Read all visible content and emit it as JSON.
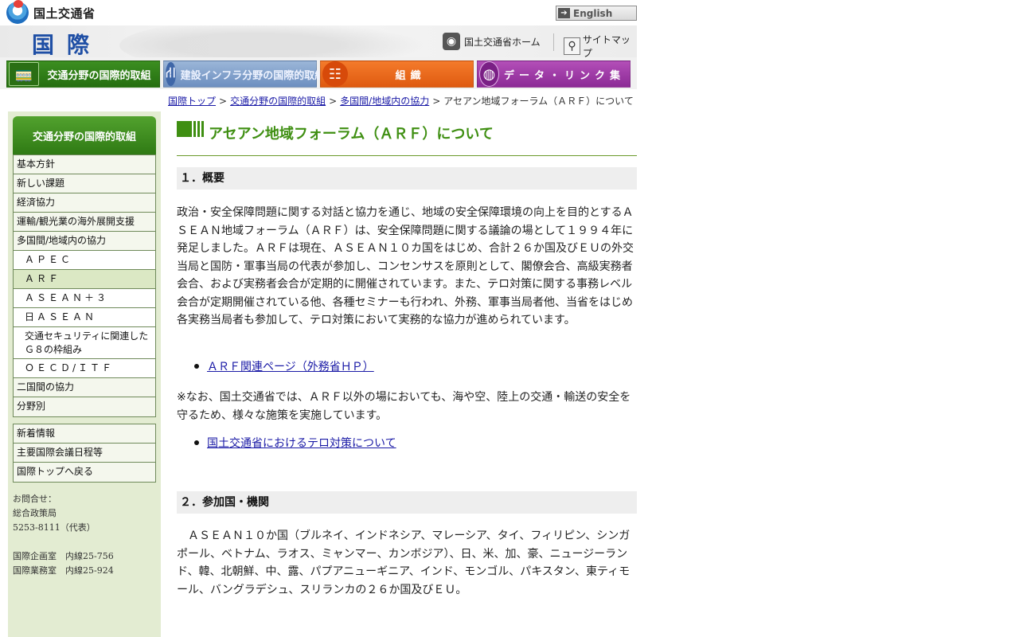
{
  "header": {
    "brand_name": "国土交通省",
    "english_label": "English",
    "section_title": "国際",
    "home_link": "国土交通省ホーム",
    "sitemap_link": "サイトマップ"
  },
  "global_nav": [
    {
      "label": "交通分野の国際的取組",
      "icon": "train-icon"
    },
    {
      "label": "建設インフラ分野の国際的取組",
      "icon": "road-icon"
    },
    {
      "label": "組織",
      "icon": "org-chart-icon"
    },
    {
      "label": "データ・リンク集",
      "icon": "globe-icon"
    }
  ],
  "breadcrumb": {
    "items": [
      "国際トップ",
      "交通分野の国際的取組",
      "多国間/地域内の協力"
    ],
    "current": "アセアン地域フォーラム（ＡＲＦ）について",
    "separator": ">"
  },
  "sidebar": {
    "title": "交通分野の国際的取組",
    "items": [
      {
        "label": "基本方針"
      },
      {
        "label": "新しい課題"
      },
      {
        "label": "経済協力"
      },
      {
        "label": "運輸/観光業の海外展開支援"
      },
      {
        "label": "多国間/地域内の協力"
      },
      {
        "label": "ＡＰＥＣ"
      },
      {
        "label": "ＡＲＦ"
      },
      {
        "label": "ＡＳＥＡＮ＋３"
      },
      {
        "label": "日ＡＳＥＡＮ"
      },
      {
        "label": "交通セキュリティに関連したＧ８の枠組み"
      },
      {
        "label": "ＯＥＣＤ/ＩＴＦ"
      },
      {
        "label": "二国間の協力"
      },
      {
        "label": "分野別"
      }
    ],
    "items2": [
      {
        "label": "新着情報"
      },
      {
        "label": "主要国際会議日程等"
      },
      {
        "label": "国際トップへ戻る"
      }
    ],
    "contact": "お問合せ：\n総合政策局\n5253-8111（代表）\n\n国際企画室　内線25-756\n国際業務室　内線25-924"
  },
  "main": {
    "title": "アセアン地域フォーラム（ＡＲＦ）について",
    "section1_heading": "１．概要",
    "section1_body": "政治・安全保障問題に関する対話と協力を通じ、地域の安全保障環境の向上を目的とするＡＳＥＡＮ地域フォーラム（ＡＲＦ）は、安全保障問題に関する議論の場として１９９４年に発足しました。ＡＲＦは現在、ＡＳＥＡＮ１０カ国をはじめ、合計２６か国及びＥＵの外交当局と国防・軍事当局の代表が参加し、コンセンサスを原則として、閣僚会合、高級実務者会合、および実務者会合が定期的に開催されています。また、テロ対策に関する事務レベル会合が定期開催されている他、各種セミナーも行われ、外務、軍事当局者他、当省をはじめ各実務当局者も参加して、テロ対策において実務的な協力が進められています。",
    "link1": "ＡＲＦ関連ページ（外務省ＨＰ）",
    "note": "※なお、国土交通省では、ＡＲＦ以外の場においても、海や空、陸上の交通・輸送の安全を守るため、様々な施策を実施しています。",
    "link2": "国土交通省におけるテロ対策について",
    "section2_heading": "２．参加国・機関",
    "section2_body": "　ＡＳＥＡＮ１０か国（ブルネイ、インドネシア、マレーシア、タイ、フィリピン、シンガポール、ベトナム、ラオス、ミャンマー、カンボジア）、日、米、加、豪、ニュージーランド、韓、北朝鮮、中、露、パプアニューギニア、インド、モンゴル、パキスタン、東ティモール、バングラデシュ、スリランカの２６か国及びＥＵ。"
  },
  "colors": {
    "accent_green": "#3f8f12",
    "sidebar_bg": "#e3ecd2",
    "link": "#1a1aa6"
  }
}
